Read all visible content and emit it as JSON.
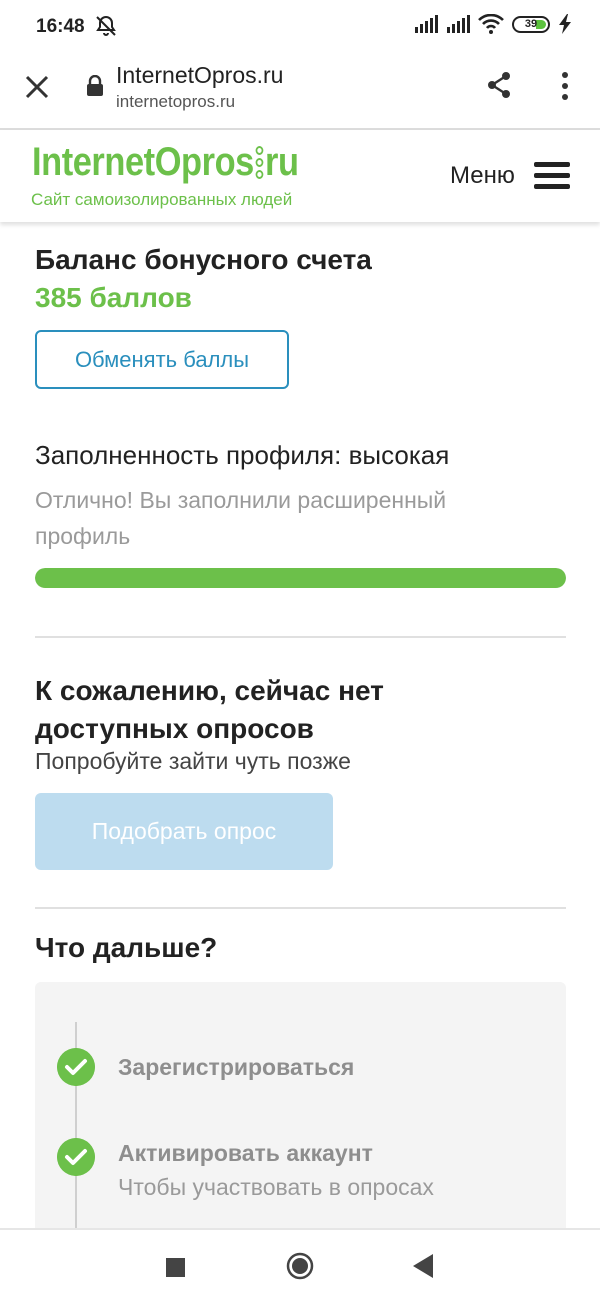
{
  "status_bar": {
    "time": "16:48",
    "battery_level": "39",
    "icons": [
      "alarm-off-icon",
      "signal-icon",
      "signal-icon",
      "wifi-icon",
      "battery-icon",
      "charging-icon"
    ]
  },
  "browser": {
    "title": "InternetOpros.ru",
    "url": "internetopros.ru",
    "icons": [
      "close-icon",
      "lock-icon",
      "share-icon",
      "more-vert-icon"
    ]
  },
  "site_header": {
    "logo_part1": "Internet",
    "logo_part2": "Opros",
    "logo_part3": "ru",
    "tagline": "Сайт самоизолированных людей",
    "menu_label": "Меню",
    "brand_color": "#6cc04a"
  },
  "balance": {
    "title": "Баланс бонусного счета",
    "value": "385 баллов",
    "exchange_button": "Обменять баллы"
  },
  "profile": {
    "title": "Заполненность профиля: высокая",
    "description": "Отлично! Вы заполнили расширенный профиль",
    "progress_fraction": 1.0
  },
  "surveys": {
    "title": "К сожалению, сейчас нет доступных опросов",
    "subtitle": "Попробуйте зайти чуть позже",
    "pick_button": "Подобрать опрос"
  },
  "next_steps": {
    "title": "Что дальше?",
    "steps": [
      {
        "label": "Зарегистрироваться",
        "done": true
      },
      {
        "label": "Активировать аккаунт",
        "desc": "Чтобы участвовать в опросах",
        "done": true
      }
    ]
  },
  "nav_bar": {
    "icons": [
      "recents-icon",
      "home-icon",
      "back-icon"
    ]
  }
}
